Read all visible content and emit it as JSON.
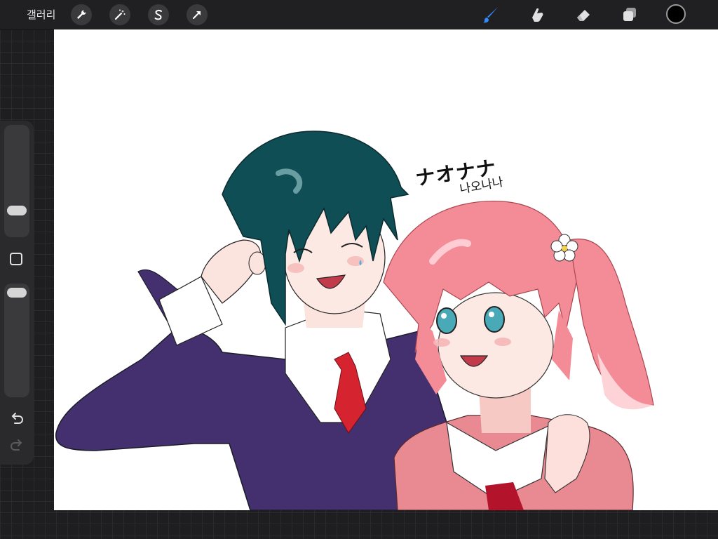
{
  "topbar": {
    "gallery_label": "갤러리",
    "tools_left": [
      {
        "name": "actions",
        "icon": "wrench-icon"
      },
      {
        "name": "adjustments",
        "icon": "magic-wand-icon"
      },
      {
        "name": "selection",
        "icon": "selection-s-icon"
      },
      {
        "name": "transform",
        "icon": "arrow-cursor-icon"
      }
    ],
    "tools_right": [
      {
        "name": "brush",
        "icon": "brush-icon",
        "active": true
      },
      {
        "name": "smudge",
        "icon": "smudge-finger-icon"
      },
      {
        "name": "eraser",
        "icon": "eraser-icon"
      },
      {
        "name": "layers",
        "icon": "layers-icon"
      }
    ],
    "current_color": "#000000",
    "accent_color": "#2f8cff"
  },
  "sidebar": {
    "brush_size_slider": {
      "icon": "size-slider"
    },
    "opacity_slider": {
      "icon": "opacity-slider"
    },
    "modify_button": {
      "icon": "square-icon"
    },
    "undo": {
      "icon": "undo-icon"
    },
    "redo": {
      "icon": "redo-icon"
    }
  },
  "artwork": {
    "katakana_text": "ナオナナ",
    "hangul_text": "나오나나"
  }
}
